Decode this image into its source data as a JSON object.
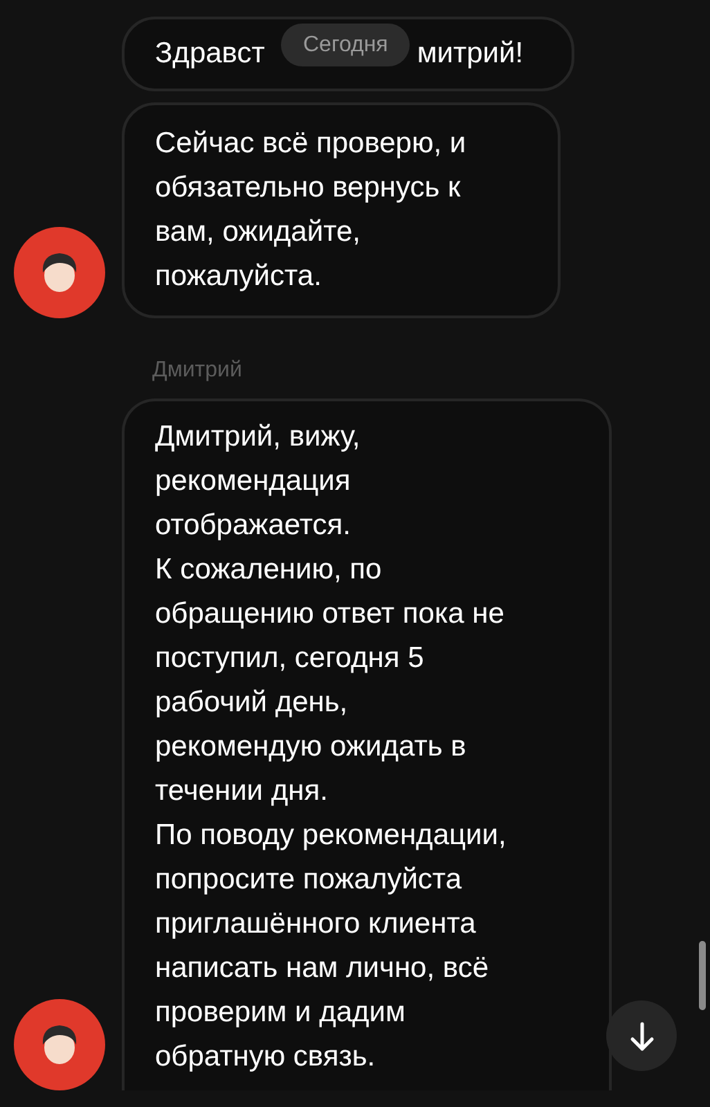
{
  "date_pill": "Сегодня",
  "messages": [
    {
      "visible_parts": [
        "Здравст",
        "митрий!"
      ],
      "avatar": false
    },
    {
      "text": "Сейчас всё проверю, и\nобязательно вернусь к\nвам, ожидайте,\nпожалуйста.",
      "avatar": true
    },
    {
      "sender": "Дмитрий",
      "text": "Дмитрий, вижу,\nрекомендация\nотображается.\nК сожалению, по\nобращению ответ пока не\nпоступил, сегодня 5\nрабочий день,\nрекомендую ожидать в\nтечении дня.\nПо поводу рекомендации,\nпопросите пожалуйста\nприглашённого клиента\nнаписать нам лично, всё\nпроверим и дадим\nобратную связь.",
      "avatar": true,
      "cut_off": true
    }
  ]
}
